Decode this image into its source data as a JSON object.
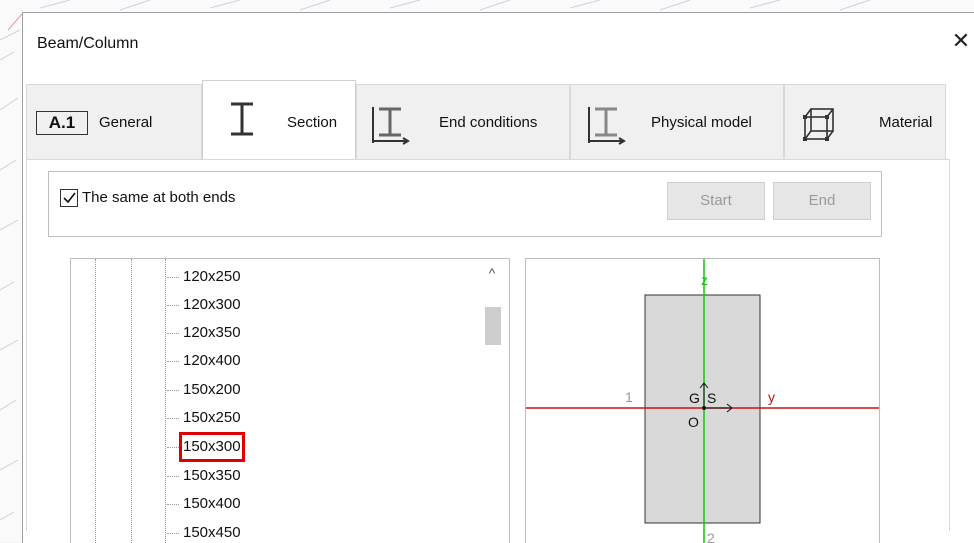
{
  "dialog": {
    "title": "Beam/Column",
    "close_icon": "close-icon"
  },
  "tabs": [
    {
      "label": "General",
      "badge": "A.1",
      "icon": "general-icon",
      "active": false
    },
    {
      "label": "Section",
      "icon": "i-section-icon",
      "active": true
    },
    {
      "label": "End conditions",
      "icon": "end-conditions-icon",
      "active": false
    },
    {
      "label": "Physical model",
      "icon": "physical-model-icon",
      "active": false
    },
    {
      "label": "Material",
      "icon": "material-icon",
      "active": false
    }
  ],
  "section": {
    "same_both_ends": {
      "label": "The same at both ends",
      "checked": true
    },
    "start_button": "Start",
    "end_button": "End"
  },
  "tree": {
    "items": [
      "120x250",
      "120x300",
      "120x350",
      "120x400",
      "150x200",
      "150x250",
      "150x300",
      "150x350",
      "150x400",
      "150x450"
    ],
    "selected": "150x300",
    "scroll_up_icon": "chevron-up-icon"
  },
  "preview": {
    "z_label": "z",
    "y_label": "y",
    "g_label": "G",
    "s_label": "S",
    "o_label": "O",
    "one_label": "1",
    "two_label": "2",
    "colors": {
      "y_axis": "#d01010",
      "z_axis": "#18c018",
      "section_fill": "#d9d9d9"
    }
  }
}
